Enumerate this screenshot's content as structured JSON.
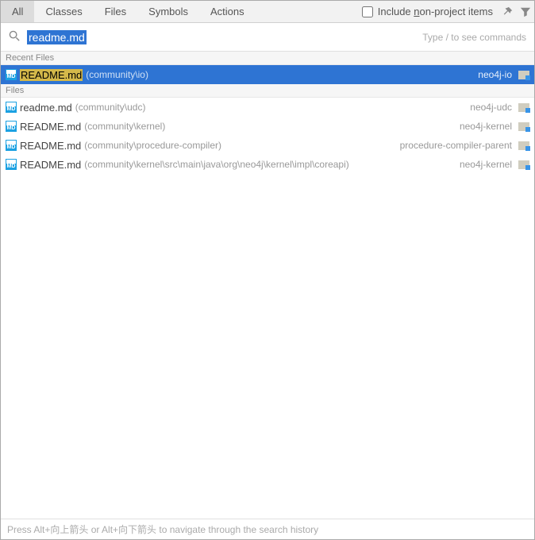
{
  "tabs": {
    "all": "All",
    "classes": "Classes",
    "files": "Files",
    "symbols": "Symbols",
    "actions": "Actions"
  },
  "include": {
    "prefix": "Include ",
    "mnemonic": "n",
    "suffix": "on-project items"
  },
  "search": {
    "query": "readme.md",
    "hint": "Type / to see commands"
  },
  "sections": {
    "recent": "Recent Files",
    "files": "Files"
  },
  "results": {
    "recent": [
      {
        "name": "README.md",
        "path": "(community\\io)",
        "module": "neo4j-io",
        "selected": true
      }
    ],
    "files": [
      {
        "name": "readme.md",
        "path": "(community\\udc)",
        "module": "neo4j-udc"
      },
      {
        "name": "README.md",
        "path": "(community\\kernel)",
        "module": "neo4j-kernel"
      },
      {
        "name": "README.md",
        "path": "(community\\procedure-compiler)",
        "module": "procedure-compiler-parent"
      },
      {
        "name": "README.md",
        "path": "(community\\kernel\\src\\main\\java\\org\\neo4j\\kernel\\impl\\coreapi)",
        "module": "neo4j-kernel"
      }
    ]
  },
  "footer": "Press Alt+向上箭头 or Alt+向下箭头 to navigate through the search history"
}
